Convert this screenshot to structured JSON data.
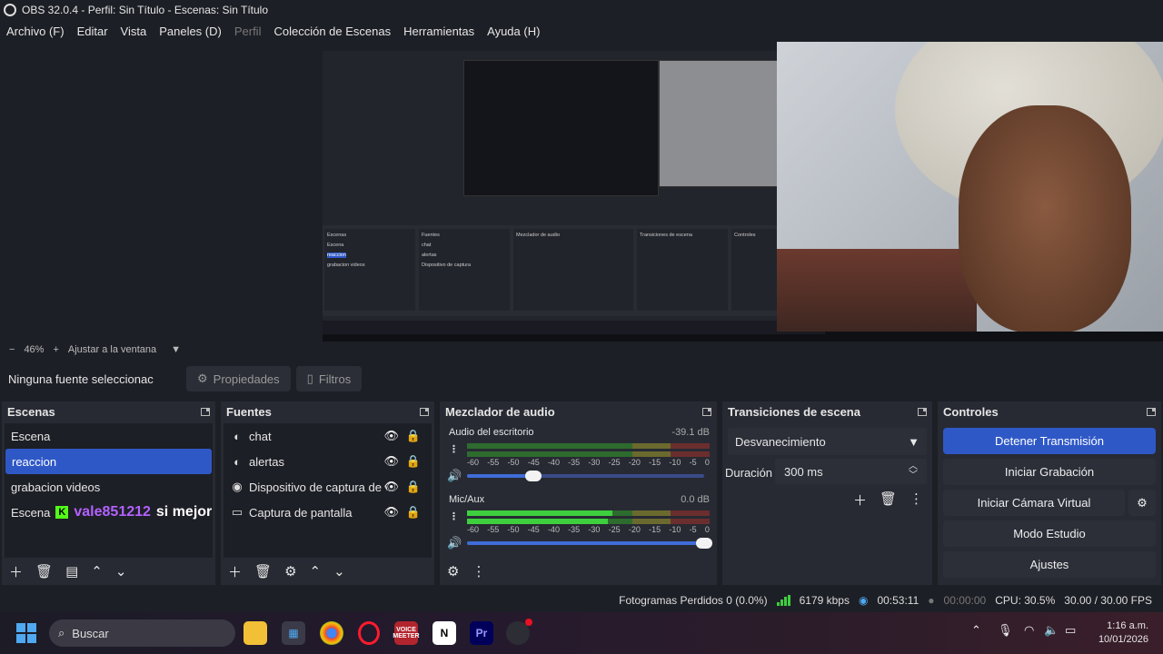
{
  "window": {
    "title": "OBS 32.0.4 - Perfil: Sin Título - Escenas: Sin Título"
  },
  "menu": [
    {
      "label": "Archivo (F)",
      "disabled": false
    },
    {
      "label": "Editar",
      "disabled": false
    },
    {
      "label": "Vista",
      "disabled": false
    },
    {
      "label": "Paneles (D)",
      "disabled": false
    },
    {
      "label": "Perfil",
      "disabled": true
    },
    {
      "label": "Colección de Escenas",
      "disabled": false
    },
    {
      "label": "Herramientas",
      "disabled": false
    },
    {
      "label": "Ayuda (H)",
      "disabled": false
    }
  ],
  "zoom": {
    "minus": "−",
    "value": "46%",
    "plus": "+",
    "fit_label": "Ajustar a la ventana"
  },
  "source_toolbar": {
    "no_source": "Ninguna fuente seleccionac",
    "properties": "Propiedades",
    "filters": "Filtros"
  },
  "scenes": {
    "title": "Escenas",
    "items": [
      {
        "label": "Escena",
        "selected": false
      },
      {
        "label": "reaccion",
        "selected": true
      },
      {
        "label": "grabacion videos",
        "selected": false
      },
      {
        "label": "Escena",
        "selected": false
      }
    ],
    "overlay": {
      "badge": "K",
      "user": "vale851212",
      "message": "si mejor"
    }
  },
  "sources": {
    "title": "Fuentes",
    "items": [
      {
        "icon": "browser-icon",
        "label": "chat"
      },
      {
        "icon": "browser-icon",
        "label": "alertas"
      },
      {
        "icon": "camera-icon",
        "label": "Dispositivo de captura de v"
      },
      {
        "icon": "monitor-icon",
        "label": "Captura de pantalla"
      }
    ]
  },
  "mixer": {
    "title": "Mezclador de audio",
    "ticks": [
      "-60",
      "-55",
      "-50",
      "-45",
      "-40",
      "-35",
      "-30",
      "-25",
      "-20",
      "-15",
      "-10",
      "-5",
      "0"
    ],
    "channels": [
      {
        "name": "Audio del escritorio",
        "db": "-39.1 dB",
        "volume": 0.28
      },
      {
        "name": "Mic/Aux",
        "db": "0.0 dB",
        "volume": 1.0
      }
    ]
  },
  "transitions": {
    "title": "Transiciones de escena",
    "selected": "Desvanecimiento",
    "duration_label": "Duración",
    "duration_value": "300 ms"
  },
  "controls": {
    "title": "Controles",
    "stop_stream": "Detener Transmisión",
    "start_recording": "Iniciar Grabación",
    "start_virtual_cam": "Iniciar Cámara Virtual",
    "studio_mode": "Modo Estudio",
    "settings": "Ajustes"
  },
  "status": {
    "dropped_frames": "Fotogramas Perdidos 0 (0.0%)",
    "bitrate": "6179 kbps",
    "stream_time": "00:53:11",
    "record_time": "00:00:00",
    "cpu": "CPU: 30.5%",
    "fps": "30.00 / 30.00 FPS"
  },
  "taskbar": {
    "search_placeholder": "Buscar",
    "time": "1:16 a.m.",
    "date": "10/01/2026",
    "apps": [
      "file-explorer-icon",
      "store-icon",
      "chrome-icon",
      "opera-icon",
      "voicemeeter-icon",
      "notion-icon",
      "premiere-icon",
      "obs-icon"
    ],
    "voicemeeter_label": "VOICE MEETER",
    "notion_label": "N",
    "premiere_label": "Pr"
  },
  "colors": {
    "accent": "#2f58c7",
    "dock_bg": "#272a33",
    "panel_bg": "#1d1f26",
    "meter_green": "#3ecf3e",
    "chat_user": "#b362ff",
    "kick_green": "#53fc18"
  }
}
